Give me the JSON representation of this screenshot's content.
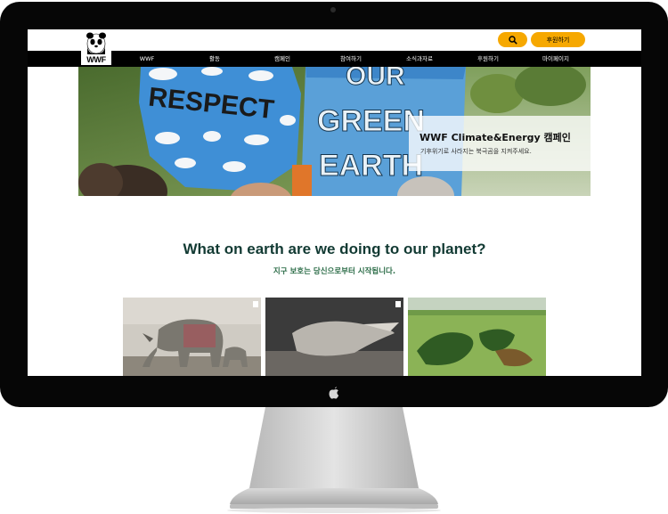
{
  "site": {
    "logo_text": "WWF",
    "donate_button": "후원하기",
    "nav": [
      "WWF",
      "활동",
      "캠페인",
      "참여하기",
      "소식과자료",
      "후원하기",
      "마이페이지"
    ]
  },
  "hero": {
    "title": "WWF Climate&Energy 캠페인",
    "subtitle": "기후위기로 사라지는 북극곰을 지켜주세요.",
    "sign_left": "RESPECT",
    "sign_right": [
      "OUR",
      "GREEN",
      "EARTH"
    ]
  },
  "intro": {
    "title": "What on earth are we doing to our planet?",
    "subtitle": "지구 보호는 당신으로부터 시작됩니다."
  },
  "icons": [
    "camera-icon",
    "panda-logo-icon",
    "search-icon",
    "apple-logo-icon"
  ],
  "colors": {
    "accent": "#f6a800",
    "nav_background": "#000000",
    "heading": "#123a33",
    "subheading": "#2a6b46"
  }
}
